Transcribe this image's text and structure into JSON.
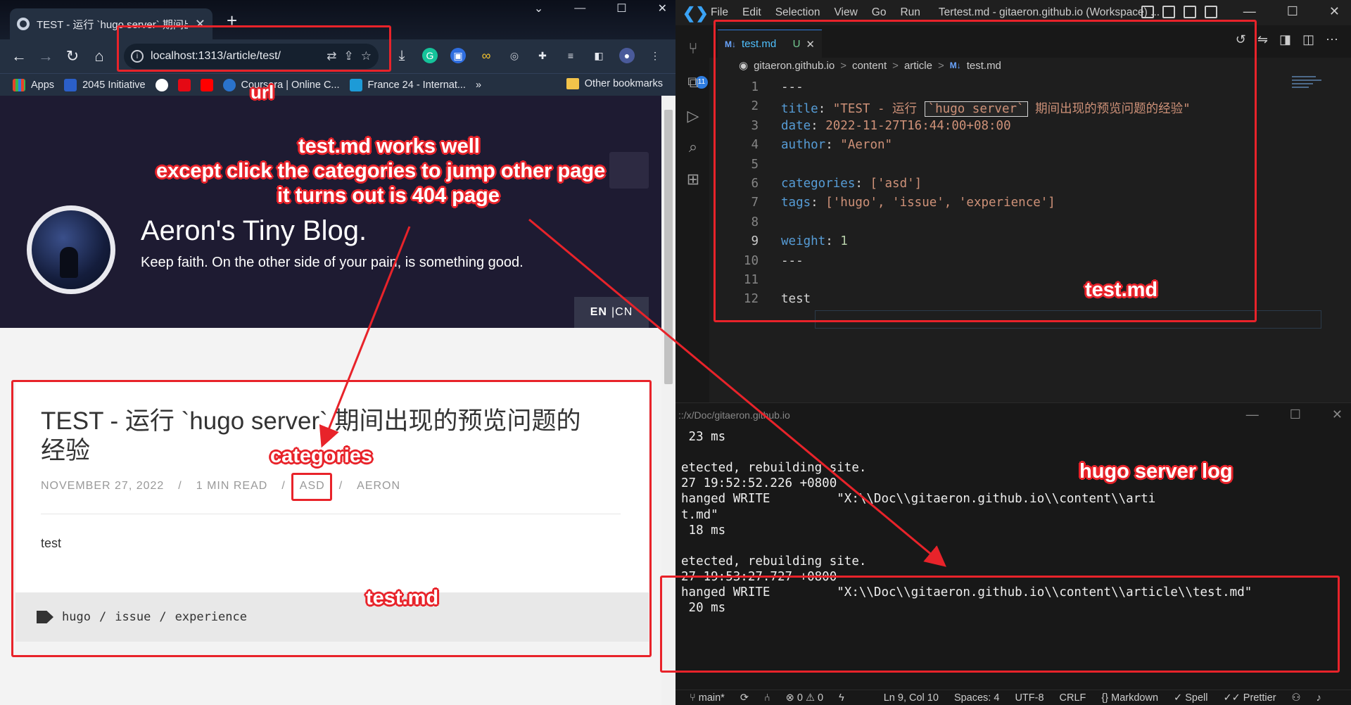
{
  "browser": {
    "tab_title": "TEST - 运行 `hugo server` 期间出",
    "url": "localhost:1313/article/test/",
    "bookmarks": [
      "Apps",
      "2045 Initiative",
      "Coursera | Online C...",
      "France 24 - Internat..."
    ],
    "other_bookmarks": "Other bookmarks",
    "more_bookmarks": "»"
  },
  "blog": {
    "title": "Aeron's Tiny Blog.",
    "tagline": "Keep faith. On the other side of your pain, is something good.",
    "lang_en": "EN",
    "lang_cn": "|CN"
  },
  "article": {
    "title": "TEST - 运行 `hugo server` 期间出现的预览问题的经验",
    "date": "NOVEMBER 27, 2022",
    "read_time": "1 MIN READ",
    "category": "ASD",
    "author": "AERON",
    "sep": "/",
    "body": "test",
    "tags": [
      "hugo",
      "issue",
      "experience"
    ],
    "tag_sep": "/"
  },
  "vscode": {
    "menus": [
      "File",
      "Edit",
      "Selection",
      "View",
      "Go",
      "Run"
    ],
    "window_title": "Tertest.md - gitaeron.github.io (Workspace) ...",
    "tab_name": "test.md",
    "tab_status": "U",
    "tab_lang": "M↓",
    "activity_badge": "11",
    "breadcrumbs": [
      "gitaeron.github.io",
      "content",
      "article",
      "test.md"
    ],
    "breadcrumb_sep": ">",
    "code_lines": [
      {
        "n": "1",
        "text": "---"
      },
      {
        "n": "2",
        "key": "title",
        "value_pre": "\"TEST - 运行 ",
        "inline": "`hugo server`",
        "value_post": " 期间出现的预览问题的经验\""
      },
      {
        "n": "3",
        "key": "date",
        "value": "2022-11-27T16:44:00+08:00"
      },
      {
        "n": "4",
        "key": "author",
        "value": "\"Aeron\""
      },
      {
        "n": "5",
        "text": ""
      },
      {
        "n": "6",
        "key": "categories",
        "value": "['asd']"
      },
      {
        "n": "7",
        "key": "tags",
        "value": "['hugo', 'issue', 'experience']"
      },
      {
        "n": "8",
        "text": ""
      },
      {
        "n": "9",
        "key": "weight",
        "value": "1"
      },
      {
        "n": "10",
        "text": "---"
      },
      {
        "n": "11",
        "text": ""
      },
      {
        "n": "12",
        "text": "test"
      }
    ],
    "active_line": "9",
    "terminal_path": "::/x/Doc/gitaeron.github.io",
    "terminal_lines": [
      " 23 ms",
      "",
      "etected, rebuilding site.",
      "27 19:52:52.226 +0800",
      "hanged WRITE         \"X:\\\\Doc\\\\gitaeron.github.io\\\\content\\\\arti",
      "t.md\"",
      " 18 ms",
      "",
      "etected, rebuilding site.",
      "27 19:53:27.727 +0800",
      "hanged WRITE         \"X:\\\\Doc\\\\gitaeron.github.io\\\\content\\\\article\\\\test.md\"",
      " 20 ms"
    ],
    "status": {
      "branch": "main*",
      "problems": "⊗ 0 ⚠ 0",
      "position": "Ln 9, Col 10",
      "spaces": "Spaces: 4",
      "encoding": "UTF-8",
      "eol": "CRLF",
      "language": "Markdown",
      "spell": "Spell",
      "prettier": "Prettier"
    }
  },
  "annotations": {
    "url": "url",
    "headline_1": "test.md works well",
    "headline_2": "except click the categories to jump other page",
    "headline_3": "it turns out is 404 page",
    "categories": "categories",
    "test_md_page": "test.md",
    "test_md_editor": "test.md",
    "server_log": "hugo server log",
    "color": "#e8232a"
  }
}
